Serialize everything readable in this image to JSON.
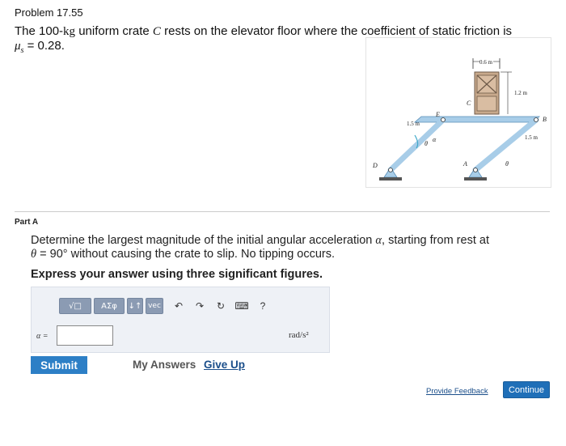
{
  "problem": {
    "title": "Problem 17.55"
  },
  "statement": {
    "part1": "The 100-",
    "kg": "kg",
    "part2": " uniform crate ",
    "crate": "C",
    "part3": " rests on the elevator floor where the coefficient of static friction is",
    "mu": "μ",
    "mu_sub": "s",
    "mu_value": " = 0.28."
  },
  "figure": {
    "label_top": "0.6 m",
    "label_height": "1.2 m",
    "label_left": "1.5 m",
    "label_right": "1.5 m",
    "point_C": "C",
    "point_E": "E",
    "point_B": "B",
    "point_D": "D",
    "point_A": "A",
    "theta": "θ",
    "alpha": "α"
  },
  "partA": {
    "label": "Part A",
    "question_1": "Determine the largest magnitude of the initial angular acceleration ",
    "alpha": "α",
    "question_2": ", starting from rest at",
    "theta": "θ",
    "question_3": " = 90° without causing the crate to slip. No tipping occurs.",
    "instruction": "Express your answer using three significant figures."
  },
  "toolbar": {
    "template_label": "√□",
    "symbols_label": "ΑΣφ",
    "arrows_label": "↓↑",
    "vec_label": "vec",
    "undo_icon": "↶",
    "redo_icon": "↷",
    "reset_icon": "↻",
    "keyboard_icon": "⌨",
    "help_label": "?"
  },
  "answer": {
    "var_label": "α =",
    "value": "",
    "placeholder": "",
    "unit": "rad/s²"
  },
  "actions": {
    "submit": "Submit",
    "my_answers": "My Answers",
    "give_up": "Give Up",
    "feedback": "Provide Feedback",
    "continue": "Continue"
  },
  "colors": {
    "submit_bg": "#2d7fc6",
    "continue_bg": "#1f6fb8",
    "link": "#1a4e8a",
    "answer_panel": "#eef1f6",
    "toolbar_btn": "#8b9bb3",
    "linkage": "#a8cde8"
  }
}
